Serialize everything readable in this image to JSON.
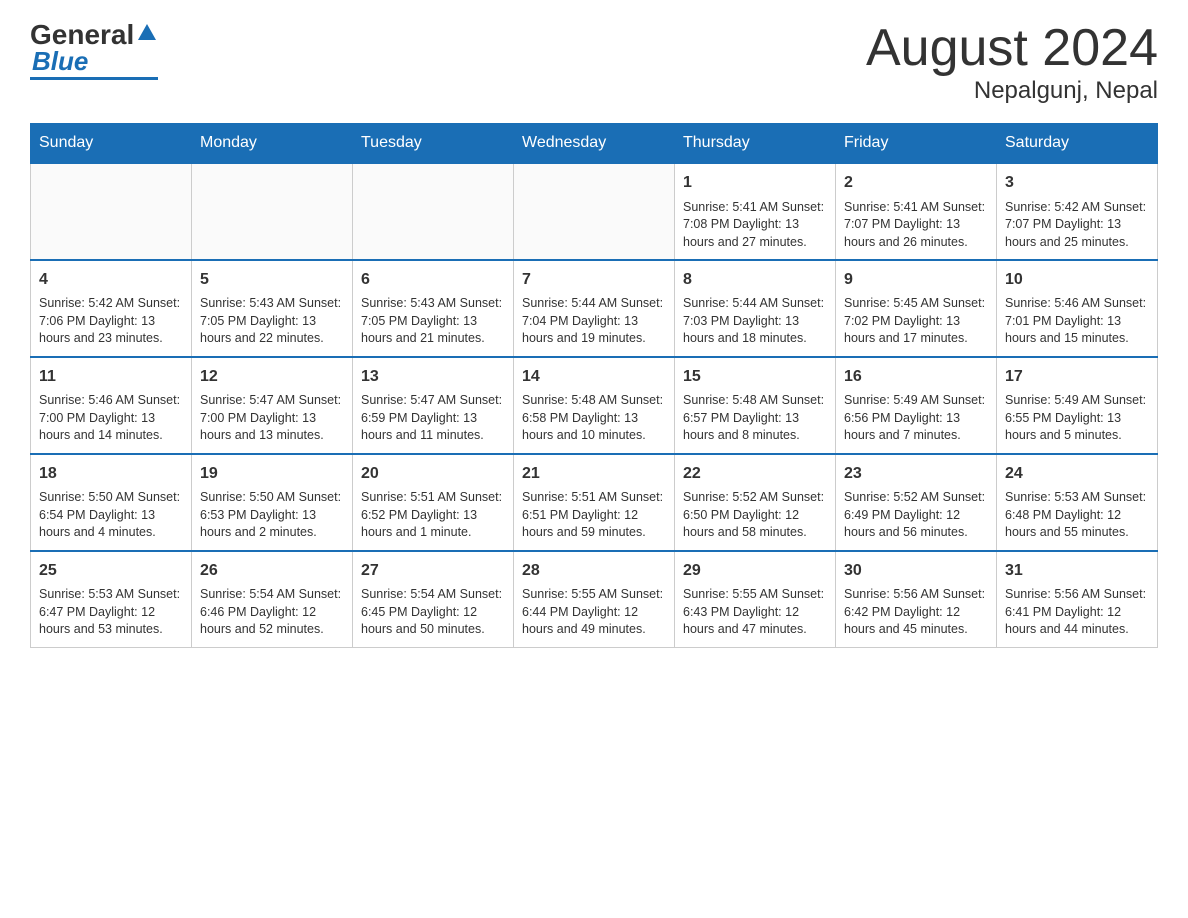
{
  "header": {
    "logo_general": "General",
    "logo_blue": "Blue",
    "title": "August 2024",
    "subtitle": "Nepalgunj, Nepal"
  },
  "weekdays": [
    "Sunday",
    "Monday",
    "Tuesday",
    "Wednesday",
    "Thursday",
    "Friday",
    "Saturday"
  ],
  "weeks": [
    [
      {
        "day": "",
        "info": ""
      },
      {
        "day": "",
        "info": ""
      },
      {
        "day": "",
        "info": ""
      },
      {
        "day": "",
        "info": ""
      },
      {
        "day": "1",
        "info": "Sunrise: 5:41 AM\nSunset: 7:08 PM\nDaylight: 13 hours and 27 minutes."
      },
      {
        "day": "2",
        "info": "Sunrise: 5:41 AM\nSunset: 7:07 PM\nDaylight: 13 hours and 26 minutes."
      },
      {
        "day": "3",
        "info": "Sunrise: 5:42 AM\nSunset: 7:07 PM\nDaylight: 13 hours and 25 minutes."
      }
    ],
    [
      {
        "day": "4",
        "info": "Sunrise: 5:42 AM\nSunset: 7:06 PM\nDaylight: 13 hours and 23 minutes."
      },
      {
        "day": "5",
        "info": "Sunrise: 5:43 AM\nSunset: 7:05 PM\nDaylight: 13 hours and 22 minutes."
      },
      {
        "day": "6",
        "info": "Sunrise: 5:43 AM\nSunset: 7:05 PM\nDaylight: 13 hours and 21 minutes."
      },
      {
        "day": "7",
        "info": "Sunrise: 5:44 AM\nSunset: 7:04 PM\nDaylight: 13 hours and 19 minutes."
      },
      {
        "day": "8",
        "info": "Sunrise: 5:44 AM\nSunset: 7:03 PM\nDaylight: 13 hours and 18 minutes."
      },
      {
        "day": "9",
        "info": "Sunrise: 5:45 AM\nSunset: 7:02 PM\nDaylight: 13 hours and 17 minutes."
      },
      {
        "day": "10",
        "info": "Sunrise: 5:46 AM\nSunset: 7:01 PM\nDaylight: 13 hours and 15 minutes."
      }
    ],
    [
      {
        "day": "11",
        "info": "Sunrise: 5:46 AM\nSunset: 7:00 PM\nDaylight: 13 hours and 14 minutes."
      },
      {
        "day": "12",
        "info": "Sunrise: 5:47 AM\nSunset: 7:00 PM\nDaylight: 13 hours and 13 minutes."
      },
      {
        "day": "13",
        "info": "Sunrise: 5:47 AM\nSunset: 6:59 PM\nDaylight: 13 hours and 11 minutes."
      },
      {
        "day": "14",
        "info": "Sunrise: 5:48 AM\nSunset: 6:58 PM\nDaylight: 13 hours and 10 minutes."
      },
      {
        "day": "15",
        "info": "Sunrise: 5:48 AM\nSunset: 6:57 PM\nDaylight: 13 hours and 8 minutes."
      },
      {
        "day": "16",
        "info": "Sunrise: 5:49 AM\nSunset: 6:56 PM\nDaylight: 13 hours and 7 minutes."
      },
      {
        "day": "17",
        "info": "Sunrise: 5:49 AM\nSunset: 6:55 PM\nDaylight: 13 hours and 5 minutes."
      }
    ],
    [
      {
        "day": "18",
        "info": "Sunrise: 5:50 AM\nSunset: 6:54 PM\nDaylight: 13 hours and 4 minutes."
      },
      {
        "day": "19",
        "info": "Sunrise: 5:50 AM\nSunset: 6:53 PM\nDaylight: 13 hours and 2 minutes."
      },
      {
        "day": "20",
        "info": "Sunrise: 5:51 AM\nSunset: 6:52 PM\nDaylight: 13 hours and 1 minute."
      },
      {
        "day": "21",
        "info": "Sunrise: 5:51 AM\nSunset: 6:51 PM\nDaylight: 12 hours and 59 minutes."
      },
      {
        "day": "22",
        "info": "Sunrise: 5:52 AM\nSunset: 6:50 PM\nDaylight: 12 hours and 58 minutes."
      },
      {
        "day": "23",
        "info": "Sunrise: 5:52 AM\nSunset: 6:49 PM\nDaylight: 12 hours and 56 minutes."
      },
      {
        "day": "24",
        "info": "Sunrise: 5:53 AM\nSunset: 6:48 PM\nDaylight: 12 hours and 55 minutes."
      }
    ],
    [
      {
        "day": "25",
        "info": "Sunrise: 5:53 AM\nSunset: 6:47 PM\nDaylight: 12 hours and 53 minutes."
      },
      {
        "day": "26",
        "info": "Sunrise: 5:54 AM\nSunset: 6:46 PM\nDaylight: 12 hours and 52 minutes."
      },
      {
        "day": "27",
        "info": "Sunrise: 5:54 AM\nSunset: 6:45 PM\nDaylight: 12 hours and 50 minutes."
      },
      {
        "day": "28",
        "info": "Sunrise: 5:55 AM\nSunset: 6:44 PM\nDaylight: 12 hours and 49 minutes."
      },
      {
        "day": "29",
        "info": "Sunrise: 5:55 AM\nSunset: 6:43 PM\nDaylight: 12 hours and 47 minutes."
      },
      {
        "day": "30",
        "info": "Sunrise: 5:56 AM\nSunset: 6:42 PM\nDaylight: 12 hours and 45 minutes."
      },
      {
        "day": "31",
        "info": "Sunrise: 5:56 AM\nSunset: 6:41 PM\nDaylight: 12 hours and 44 minutes."
      }
    ]
  ]
}
